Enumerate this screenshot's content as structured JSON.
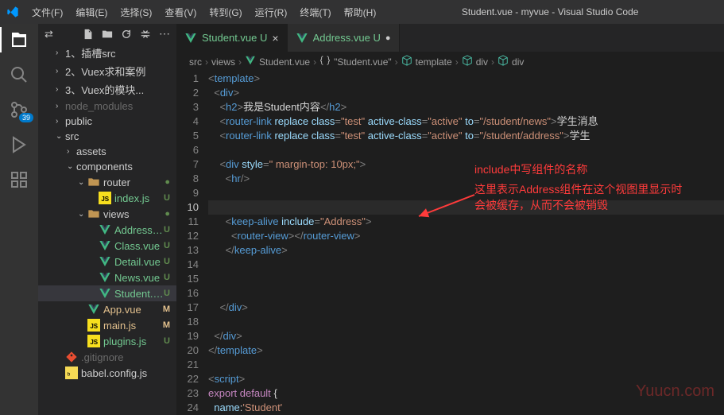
{
  "title": "Student.vue - myvue - Visual Studio Code",
  "menubar": [
    "文件(F)",
    "编辑(E)",
    "选择(S)",
    "查看(V)",
    "转到(G)",
    "运行(R)",
    "终端(T)",
    "帮助(H)"
  ],
  "activity_badge": "39",
  "explorer_actions": [
    "new-file",
    "new-folder",
    "refresh",
    "collapse"
  ],
  "tree": [
    {
      "depth": 1,
      "arrow": "›",
      "label": "1、插槽src",
      "dim": false
    },
    {
      "depth": 1,
      "arrow": "›",
      "label": "2、Vuex求和案例",
      "dim": false
    },
    {
      "depth": 1,
      "arrow": "›",
      "label": "3、Vuex的模块...",
      "dim": false
    },
    {
      "depth": 1,
      "arrow": "›",
      "label": "node_modules",
      "dim": true
    },
    {
      "depth": 1,
      "arrow": "›",
      "label": "public",
      "dim": false
    },
    {
      "depth": 1,
      "arrow": "⌄",
      "label": "src",
      "dim": false
    },
    {
      "depth": 2,
      "arrow": "›",
      "label": "assets",
      "dim": false
    },
    {
      "depth": 2,
      "arrow": "⌄",
      "label": "components",
      "dim": false
    },
    {
      "depth": 3,
      "arrow": "⌄",
      "label": "router",
      "icon": "folder",
      "status": "●",
      "dim": false
    },
    {
      "depth": 4,
      "arrow": "",
      "label": "index.js",
      "icon": "js",
      "status": "U",
      "unt": true
    },
    {
      "depth": 3,
      "arrow": "⌄",
      "label": "views",
      "icon": "folder",
      "status": "●",
      "dim": false
    },
    {
      "depth": 4,
      "arrow": "",
      "label": "Address.vue",
      "icon": "vue",
      "status": "U",
      "unt": true
    },
    {
      "depth": 4,
      "arrow": "",
      "label": "Class.vue",
      "icon": "vue",
      "status": "U",
      "unt": true
    },
    {
      "depth": 4,
      "arrow": "",
      "label": "Detail.vue",
      "icon": "vue",
      "status": "U",
      "unt": true
    },
    {
      "depth": 4,
      "arrow": "",
      "label": "News.vue",
      "icon": "vue",
      "status": "U",
      "unt": true
    },
    {
      "depth": 4,
      "arrow": "",
      "label": "Student.vue",
      "icon": "vue",
      "status": "U",
      "unt": true,
      "selected": true
    },
    {
      "depth": 3,
      "arrow": "",
      "label": "App.vue",
      "icon": "vue",
      "status": "M",
      "mod": true
    },
    {
      "depth": 3,
      "arrow": "",
      "label": "main.js",
      "icon": "js",
      "status": "M",
      "mod": true
    },
    {
      "depth": 3,
      "arrow": "",
      "label": "plugins.js",
      "icon": "js",
      "status": "U",
      "unt": true
    },
    {
      "depth": 1,
      "arrow": "",
      "label": ".gitignore",
      "icon": "git",
      "dim": true
    },
    {
      "depth": 1,
      "arrow": "",
      "label": "babel.config.js",
      "icon": "babel",
      "dim": false
    }
  ],
  "tabs": [
    {
      "label": "Student.vue",
      "status": "U",
      "active": true,
      "close": "×"
    },
    {
      "label": "Address.vue",
      "status": "U",
      "active": false,
      "close": ""
    }
  ],
  "breadcrumbs": [
    "src",
    "views",
    "Student.vue",
    "\"Student.vue\"",
    "template",
    "div",
    "div"
  ],
  "bc_icons": [
    "",
    "",
    "vue",
    "braces",
    "cube",
    "cube",
    "cube"
  ],
  "code_lines": [
    {
      "n": 1,
      "html": "<span class='pn'>&lt;</span><span class='tag'>template</span><span class='pn'>&gt;</span>"
    },
    {
      "n": 2,
      "html": "  <span class='pn'>&lt;</span><span class='tag'>div</span><span class='pn'>&gt;</span>"
    },
    {
      "n": 3,
      "html": "    <span class='pn'>&lt;</span><span class='tag'>h2</span><span class='pn'>&gt;</span><span class='txt'>我是Student内容</span><span class='pn'>&lt;/</span><span class='tag'>h2</span><span class='pn'>&gt;</span>"
    },
    {
      "n": 4,
      "html": "    <span class='pn'>&lt;</span><span class='tag'>router-link</span> <span class='attr'>replace</span> <span class='attr'>class</span><span class='pn'>=</span><span class='str'>\"test\"</span> <span class='attr'>active-class</span><span class='pn'>=</span><span class='str'>\"active\"</span> <span class='attr'>to</span><span class='pn'>=</span><span class='str'>\"/student/news\"</span><span class='pn'>&gt;</span><span class='txt'>学生消息</span>"
    },
    {
      "n": 5,
      "html": "    <span class='pn'>&lt;</span><span class='tag'>router-link</span> <span class='attr'>replace</span> <span class='attr'>class</span><span class='pn'>=</span><span class='str'>\"test\"</span> <span class='attr'>active-class</span><span class='pn'>=</span><span class='str'>\"active\"</span> <span class='attr'>to</span><span class='pn'>=</span><span class='str'>\"/student/address\"</span><span class='pn'>&gt;</span><span class='txt'>学生</span>"
    },
    {
      "n": 6,
      "html": ""
    },
    {
      "n": 7,
      "html": "    <span class='pn'>&lt;</span><span class='tag'>div</span> <span class='attr'>style</span><span class='pn'>=</span><span class='str'>\" margin-top: 10px;\"</span><span class='pn'>&gt;</span>"
    },
    {
      "n": 8,
      "html": "      <span class='pn'>&lt;</span><span class='tag'>hr</span><span class='pn'>/&gt;</span>"
    },
    {
      "n": 9,
      "html": ""
    },
    {
      "n": 10,
      "html": "",
      "cur": true
    },
    {
      "n": 11,
      "html": "      <span class='pn'>&lt;</span><span class='tag'>keep-alive</span> <span class='attr'>include</span><span class='pn'>=</span><span class='str'>\"Address\"</span><span class='pn'>&gt;</span>"
    },
    {
      "n": 12,
      "html": "        <span class='pn'>&lt;</span><span class='tag'>router-view</span><span class='pn'>&gt;&lt;/</span><span class='tag'>router-view</span><span class='pn'>&gt;</span>"
    },
    {
      "n": 13,
      "html": "      <span class='pn'>&lt;/</span><span class='tag'>keep-alive</span><span class='pn'>&gt;</span>"
    },
    {
      "n": 14,
      "html": ""
    },
    {
      "n": 15,
      "html": ""
    },
    {
      "n": 16,
      "html": ""
    },
    {
      "n": 17,
      "html": "    <span class='pn'>&lt;/</span><span class='tag'>div</span><span class='pn'>&gt;</span>"
    },
    {
      "n": 18,
      "html": ""
    },
    {
      "n": 19,
      "html": "  <span class='pn'>&lt;/</span><span class='tag'>div</span><span class='pn'>&gt;</span>"
    },
    {
      "n": 20,
      "html": "<span class='pn'>&lt;/</span><span class='tag'>template</span><span class='pn'>&gt;</span>"
    },
    {
      "n": 21,
      "html": ""
    },
    {
      "n": 22,
      "html": "<span class='pn'>&lt;</span><span class='tag'>script</span><span class='pn'>&gt;</span>"
    },
    {
      "n": 23,
      "html": "<span class='kw'>export</span> <span class='kw'>default</span> <span class='txt'>{</span>"
    },
    {
      "n": 24,
      "html": "  <span class='attr'>name</span><span class='txt'>:</span><span class='str'>'Student'</span>"
    }
  ],
  "annotations": {
    "a1": "include中写组件的名称",
    "a2": "这里表示Address组件在这个视图里显示时",
    "a3": "会被缓存，从而不会被销毁"
  },
  "watermark": "Yuucn.com"
}
